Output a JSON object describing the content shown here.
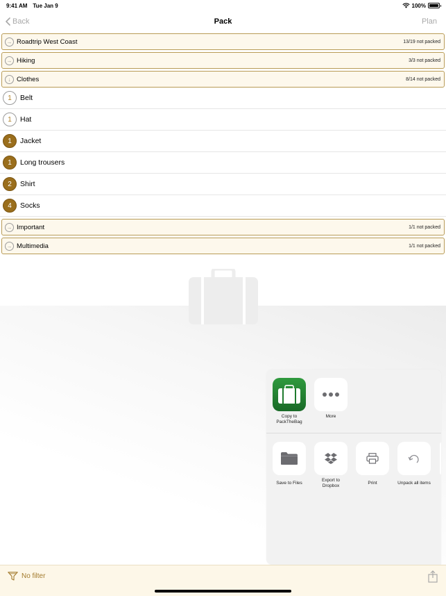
{
  "status": {
    "time": "9:41 AM",
    "date": "Tue Jan 9",
    "battery": "100%"
  },
  "nav": {
    "back_label": "Back",
    "title": "Pack",
    "plan_label": "Plan"
  },
  "groups_top": [
    {
      "label": "Roadtrip West Coast",
      "count": "13/19 not packed",
      "icon": "arrow-right-icon"
    },
    {
      "label": "Hiking",
      "count": "3/3 not packed",
      "icon": "arrow-right-icon"
    },
    {
      "label": "Clothes",
      "count": "8/14 not packed",
      "icon": "arrow-down-icon"
    }
  ],
  "items": [
    {
      "qty": "1",
      "label": "Belt",
      "style": "outline"
    },
    {
      "qty": "1",
      "label": "Hat",
      "style": "outline"
    },
    {
      "qty": "1",
      "label": "Jacket",
      "style": "filled"
    },
    {
      "qty": "1",
      "label": "Long trousers",
      "style": "filled"
    },
    {
      "qty": "2",
      "label": "Shirt",
      "style": "filled"
    },
    {
      "qty": "4",
      "label": "Socks",
      "style": "filled"
    }
  ],
  "groups_bottom": [
    {
      "label": "Important",
      "count": "1/1 not packed",
      "icon": "arrow-right-icon"
    },
    {
      "label": "Multimedia",
      "count": "1/1 not packed",
      "icon": "arrow-right-icon"
    }
  ],
  "share": {
    "apps": [
      {
        "label": "Copy to PackTheBag",
        "icon": "packthebag-app-icon"
      },
      {
        "label": "More",
        "icon": "more-dots-icon"
      }
    ],
    "actions": [
      {
        "label": "Save to Files",
        "icon": "folder-icon"
      },
      {
        "label": "Export to Dropbox",
        "icon": "dropbox-icon"
      },
      {
        "label": "Print",
        "icon": "printer-icon"
      },
      {
        "label": "Unpack all items",
        "icon": "unpack-icon"
      }
    ]
  },
  "toolbar": {
    "filter_label": "No filter",
    "filter_icon": "funnel-icon",
    "share_icon": "share-icon"
  },
  "colors": {
    "accent": "#a27a2c",
    "group_border": "#b89b56",
    "group_bg": "#fdf8ec",
    "badge_filled": "#9a6e1c",
    "app_green": "#2f9a3e"
  }
}
